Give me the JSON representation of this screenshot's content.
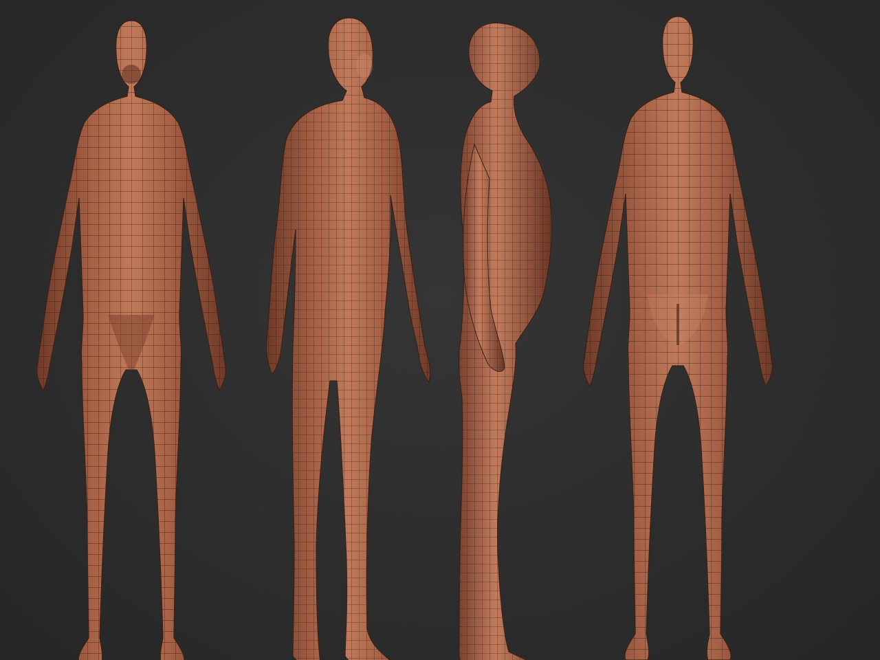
{
  "scene": {
    "background_color": "#2d2d2d",
    "model_color": "#b06a4e",
    "model_shadow_color": "#6e3a28",
    "wire_color": "#2a1a14",
    "views": [
      {
        "name": "front"
      },
      {
        "name": "three-quarter"
      },
      {
        "name": "side"
      },
      {
        "name": "back"
      }
    ]
  }
}
